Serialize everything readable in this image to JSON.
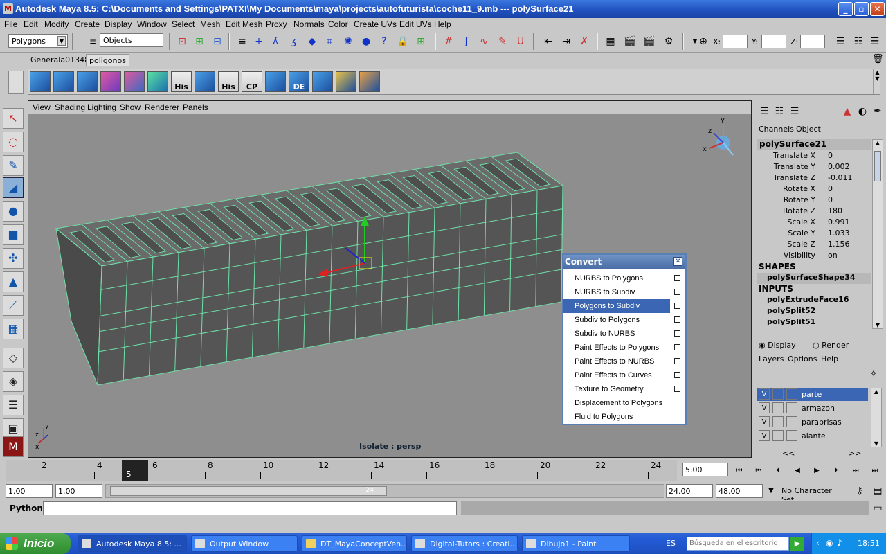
{
  "window": {
    "title": "Autodesk Maya 8.5: C:\\Documents and Settings\\PATXI\\My Documents\\maya\\projects\\autofuturista\\coche11_9.mb   ---   polySurface21"
  },
  "menubar": [
    "File",
    "Edit",
    "Modify",
    "Create",
    "Display",
    "Window",
    "Select",
    "Mesh",
    "Edit Mesh",
    "Proxy",
    "Normals",
    "Color",
    "Create UVs",
    "Edit UVs",
    "Help"
  ],
  "status": {
    "menuset": "Polygons",
    "selmode": "Objects",
    "x_label": "X:",
    "y_label": "Y:",
    "z_label": "Z:"
  },
  "shelf": {
    "tabs": [
      "Generala01348",
      "poligonos"
    ],
    "active_tab": "poligonos",
    "icon_labels": [
      "",
      "",
      "",
      "",
      "",
      "",
      "",
      "His",
      "",
      "His",
      "CP",
      "",
      "DE",
      "",
      "",
      ""
    ]
  },
  "viewport": {
    "menu": [
      "View",
      "Shading",
      "Lighting",
      "Show",
      "Renderer",
      "Panels"
    ],
    "isolate_label": "Isolate : persp",
    "axis": {
      "x": "x",
      "y": "y",
      "z": "z"
    }
  },
  "convert_menu": {
    "title": "Convert",
    "items": [
      {
        "label": "NURBS to Polygons",
        "option": true
      },
      {
        "label": "NURBS to Subdiv",
        "option": true
      },
      {
        "label": "Polygons to Subdiv",
        "option": true,
        "selected": true
      },
      {
        "label": "Subdiv to Polygons",
        "option": true
      },
      {
        "label": "Subdiv to NURBS",
        "option": true
      },
      {
        "label": "Paint Effects to Polygons",
        "option": true
      },
      {
        "label": "Paint Effects to NURBS",
        "option": true
      },
      {
        "label": "Paint Effects to Curves",
        "option": true
      },
      {
        "label": "Texture to Geometry",
        "option": true
      },
      {
        "label": "Displacement to Polygons",
        "option": false
      },
      {
        "label": "Fluid to Polygons",
        "option": false
      }
    ]
  },
  "channel_box": {
    "tabs": [
      "Channels",
      "Object"
    ],
    "object": "polySurface21",
    "attrs": [
      {
        "name": "Translate X",
        "value": "0"
      },
      {
        "name": "Translate Y",
        "value": "0.002"
      },
      {
        "name": "Translate Z",
        "value": "-0.011"
      },
      {
        "name": "Rotate X",
        "value": "0"
      },
      {
        "name": "Rotate Y",
        "value": "0"
      },
      {
        "name": "Rotate Z",
        "value": "180"
      },
      {
        "name": "Scale X",
        "value": "0.991"
      },
      {
        "name": "Scale Y",
        "value": "1.033"
      },
      {
        "name": "Scale Z",
        "value": "1.156"
      },
      {
        "name": "Visibility",
        "value": "on"
      }
    ],
    "shapes_label": "SHAPES",
    "shape": "polySurfaceShape34",
    "inputs_label": "INPUTS",
    "inputs": [
      "polyExtrudeFace16",
      "polySplit52",
      "polySplit51"
    ]
  },
  "layer_editor": {
    "radio_display": "Display",
    "radio_render": "Render",
    "menus": [
      "Layers",
      "Options",
      "Help"
    ],
    "layers": [
      {
        "v": "V",
        "name": "parte",
        "selected": true
      },
      {
        "v": "V",
        "name": "armazon",
        "selected": false
      },
      {
        "v": "V",
        "name": "parabrisas",
        "selected": false
      },
      {
        "v": "V",
        "name": "alante",
        "selected": false
      }
    ],
    "nav_left": "<<",
    "nav_right": ">>"
  },
  "timeline": {
    "ticks": [
      "2",
      "4",
      "6",
      "8",
      "10",
      "12",
      "14",
      "16",
      "18",
      "20",
      "22",
      "24"
    ],
    "current_frame": "5",
    "current_field": "5.00",
    "range_end_marker": "24"
  },
  "range": {
    "start": "1.00",
    "start2": "1.00",
    "end": "24.00",
    "end2": "48.00",
    "character_set": "No Character Set"
  },
  "command_line": {
    "label": "Python"
  },
  "taskbar": {
    "start": "Inicio",
    "tasks": [
      "Autodesk Maya 8.5: ...",
      "Output Window",
      "DT_MayaConceptVeh...",
      "Digital-Tutors : Creati...",
      "Dibujo1 - Paint"
    ],
    "lang": "ES",
    "search_placeholder": "Búsqueda en el escritorio",
    "clock": "18:51"
  }
}
